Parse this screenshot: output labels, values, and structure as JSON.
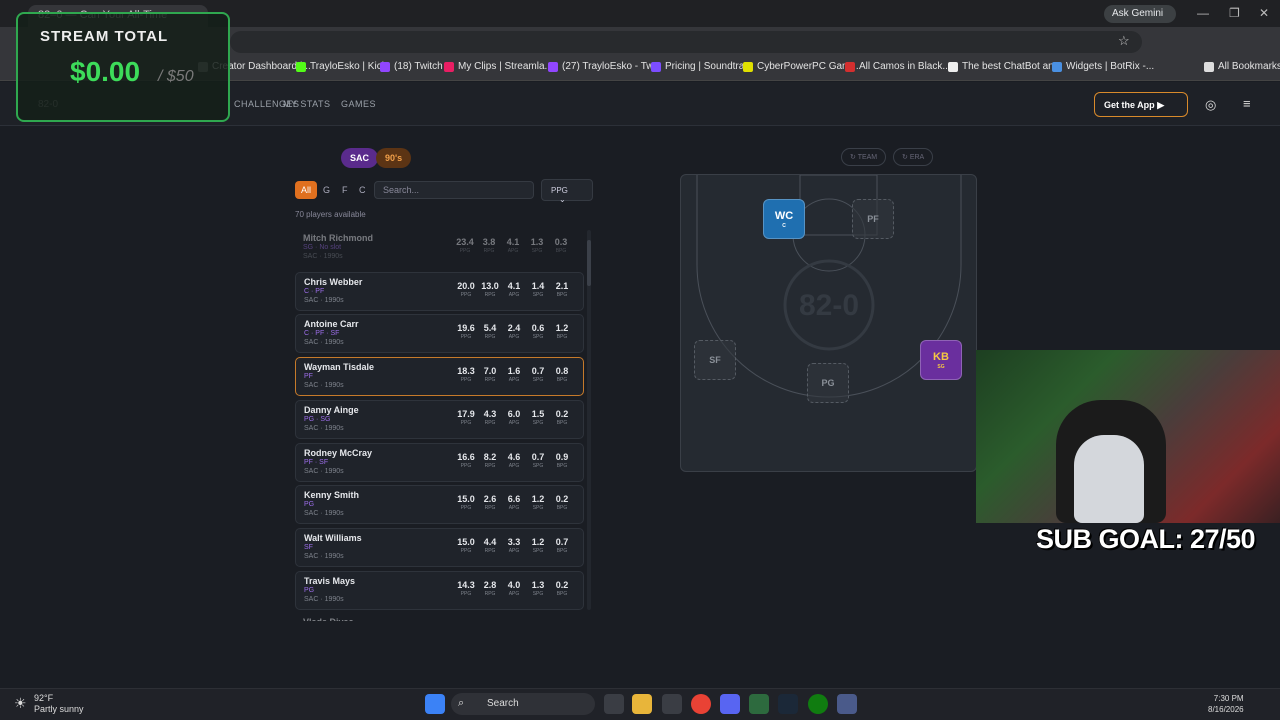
{
  "browser": {
    "tab_title": "82–0 — Can Your All-Time",
    "ask_gemini": "Ask Gemini",
    "bookmarks": [
      "Creator Dashboard |...",
      "TrayloEsko | Kick",
      "(18) Twitch",
      "My Clips | Streamla...",
      "(27) TrayloEsko - Tw...",
      "Pricing | Soundtrap",
      "CyberPowerPC Gam...",
      "All Camos in Black...",
      "The best ChatBot an...",
      "Widgets | BotRix -...",
      "All Bookmarks"
    ],
    "bookmark_colors": [
      "#888",
      "#53fc18",
      "#9146ff",
      "#e91e63",
      "#9146ff",
      "#7c4dff",
      "#e0e000",
      "#d32f2f",
      "#eee",
      "#4a90e2",
      "#ddd"
    ]
  },
  "stream_overlay": {
    "label": "STREAM TOTAL",
    "amount": "$0.00",
    "goal": "/ $50"
  },
  "site": {
    "logo_text": "82-0",
    "nav": [
      "CHALLENGES",
      "MY STATS",
      "GAMES"
    ],
    "get_app": "Get the App"
  },
  "chips": {
    "team": "SAC",
    "era": "90's",
    "team_filter": "TEAM",
    "era_filter": "ERA"
  },
  "filters": {
    "positions": [
      "All",
      "G",
      "F",
      "C"
    ],
    "search_placeholder": "Search...",
    "sort": "PPG",
    "available": "70 players available"
  },
  "stat_labels": [
    "PPG",
    "RPG",
    "APG",
    "SPG",
    "BPG"
  ],
  "players": [
    {
      "name": "Mitch Richmond",
      "pos": "SG · No slot",
      "team": "SAC · 1990s",
      "stats": [
        "23.4",
        "3.8",
        "4.1",
        "1.3",
        "0.3"
      ]
    },
    {
      "name": "Chris Webber",
      "pos": "C · PF",
      "team": "SAC · 1990s",
      "stats": [
        "20.0",
        "13.0",
        "4.1",
        "1.4",
        "2.1"
      ]
    },
    {
      "name": "Antoine Carr",
      "pos": "C · PF · SF",
      "team": "SAC · 1990s",
      "stats": [
        "19.6",
        "5.4",
        "2.4",
        "0.6",
        "1.2"
      ]
    },
    {
      "name": "Wayman Tisdale",
      "pos": "PF",
      "team": "SAC · 1990s",
      "stats": [
        "18.3",
        "7.0",
        "1.6",
        "0.7",
        "0.8"
      ]
    },
    {
      "name": "Danny Ainge",
      "pos": "PG · SG",
      "team": "SAC · 1990s",
      "stats": [
        "17.9",
        "4.3",
        "6.0",
        "1.5",
        "0.2"
      ]
    },
    {
      "name": "Rodney McCray",
      "pos": "PF · SF",
      "team": "SAC · 1990s",
      "stats": [
        "16.6",
        "8.2",
        "4.6",
        "0.7",
        "0.9"
      ]
    },
    {
      "name": "Kenny Smith",
      "pos": "PG",
      "team": "SAC · 1990s",
      "stats": [
        "15.0",
        "2.6",
        "6.6",
        "1.2",
        "0.2"
      ]
    },
    {
      "name": "Walt Williams",
      "pos": "SF",
      "team": "SAC · 1990s",
      "stats": [
        "15.0",
        "4.4",
        "3.3",
        "1.2",
        "0.7"
      ]
    },
    {
      "name": "Travis Mays",
      "pos": "PG",
      "team": "SAC · 1990s",
      "stats": [
        "14.3",
        "2.8",
        "4.0",
        "1.3",
        "0.2"
      ]
    },
    {
      "name": "Vlade Divac",
      "pos": "",
      "team": "",
      "stats": [
        "",
        "",
        "",
        "",
        ""
      ]
    }
  ],
  "court": {
    "center_logo": "82-0",
    "slots": [
      {
        "ini": "WC",
        "sub": "C",
        "filled": true,
        "color": "#1f6fb0"
      },
      {
        "ini": "PF",
        "sub": "",
        "filled": false
      },
      {
        "ini": "SF",
        "sub": "",
        "filled": false
      },
      {
        "ini": "PG",
        "sub": "",
        "filled": false
      },
      {
        "ini": "KB",
        "sub": "SG",
        "filled": true,
        "color": "#6a2f9e"
      }
    ]
  },
  "sub_goal": "SUB GOAL: 27/50",
  "taskbar": {
    "temp": "92°F",
    "weather": "Partly sunny",
    "search": "Search",
    "time": "7:30 PM",
    "date": "8/16/2026"
  }
}
